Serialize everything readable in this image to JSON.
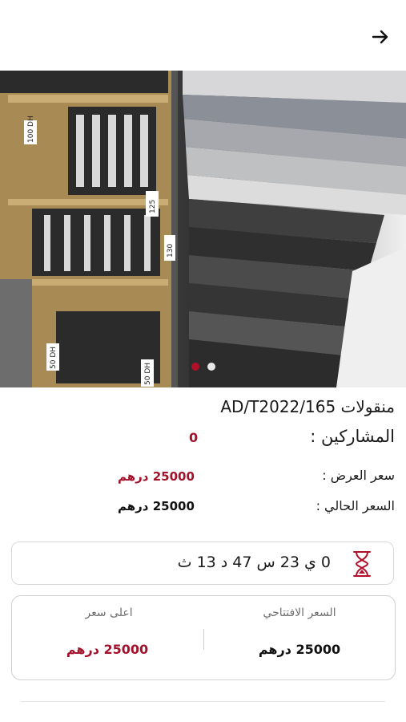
{
  "header": {
    "back_icon": "arrow-right-icon"
  },
  "gallery": {
    "images_count": 2,
    "active_index": 0,
    "image_tags": [
      "100 DH",
      "125",
      "130",
      "50 DH",
      "50 DH"
    ],
    "colors": {
      "active_dot": "#b0102a",
      "inactive_dot": "#e8e8e8"
    }
  },
  "lot": {
    "title": "منقولات AD/T2022/165",
    "participants_label": "المشاركين :",
    "participants_value": "0",
    "offer_price_label": "سعر العرض :",
    "offer_price_value": "25000 درهم",
    "current_price_label": "السعر الحالي :",
    "current_price_value": "25000 درهم"
  },
  "timer": {
    "icon": "hourglass-icon",
    "text": "0 ي 23 س 47 د 13 ث"
  },
  "bids": {
    "opening_label": "السعر الافتتاحي",
    "opening_value": "25000 درهم",
    "highest_label": "اعلى سعر",
    "highest_value": "25000 درهم"
  },
  "colors": {
    "accent": "#a3122a",
    "text": "#1a1a1a",
    "muted": "#6e6e6e"
  }
}
